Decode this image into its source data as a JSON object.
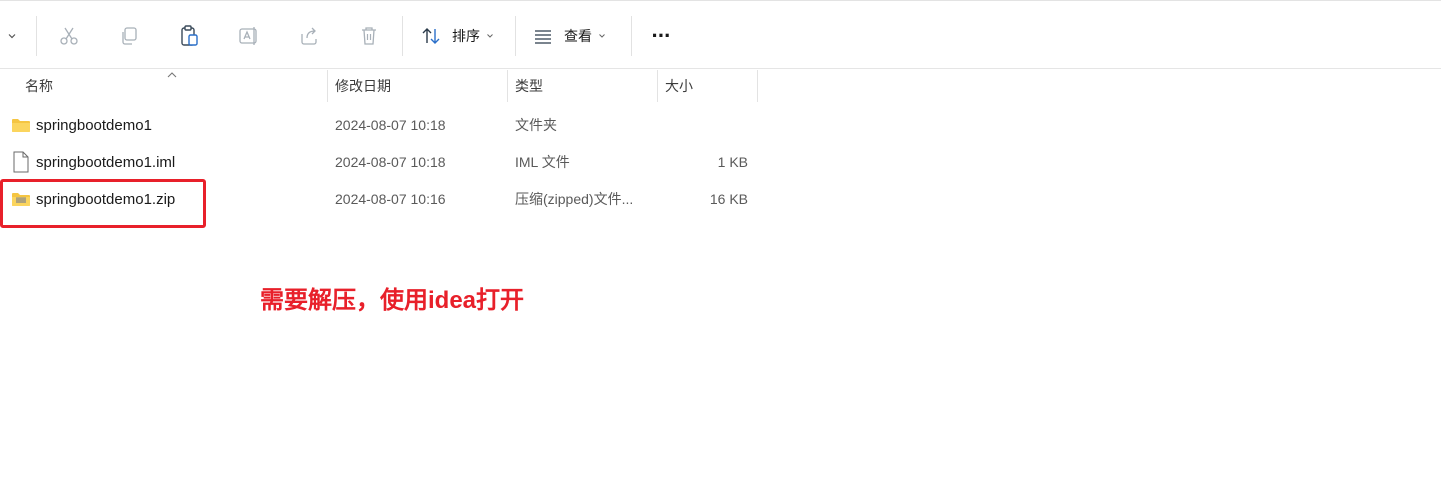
{
  "toolbar": {
    "sort_label": "排序",
    "view_label": "查看",
    "more_label": "···"
  },
  "columns": {
    "name": "名称",
    "modified": "修改日期",
    "type": "类型",
    "size": "大小"
  },
  "files": [
    {
      "name": "springbootdemo1",
      "modified": "2024-08-07 10:18",
      "type": "文件夹",
      "size": "",
      "icon": "folder-icon"
    },
    {
      "name": "springbootdemo1.iml",
      "modified": "2024-08-07 10:18",
      "type": "IML 文件",
      "size": "1 KB",
      "icon": "file-icon"
    },
    {
      "name": "springbootdemo1.zip",
      "modified": "2024-08-07 10:16",
      "type": "压缩(zipped)文件...",
      "size": "16 KB",
      "icon": "zip-folder-icon"
    }
  ],
  "annotation": "需要解压，使用idea打开",
  "colors": {
    "highlight": "#e8202a",
    "folder": "#f5c542"
  }
}
